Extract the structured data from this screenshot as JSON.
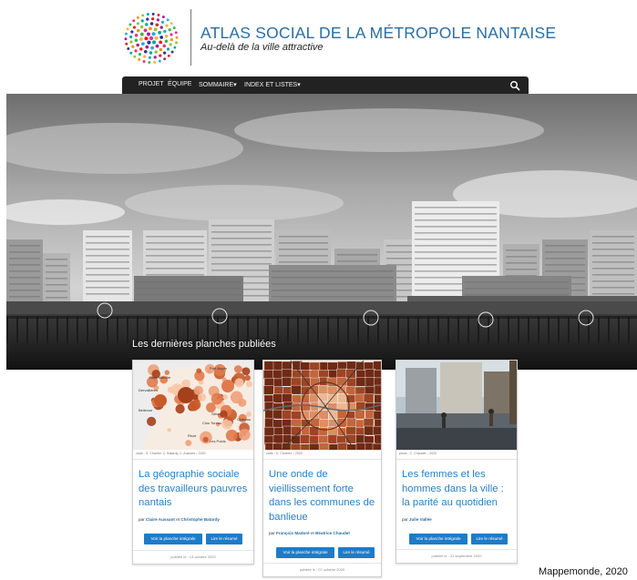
{
  "header": {
    "title": "ATLAS SOCIAL DE LA MÉTROPOLE NANTAISE",
    "subtitle": "Au-delà de la ville attractive"
  },
  "nav": {
    "items": [
      {
        "label": "PROJET"
      },
      {
        "label": "ÉQUIPE"
      },
      {
        "label": "SOMMAIRE▾"
      },
      {
        "label": "INDEX ET LISTES▾"
      }
    ],
    "search_icon": "search-icon"
  },
  "hero": {
    "caption": "Les dernières planches publiées"
  },
  "cards": [
    {
      "credit": "carte : G. Charrier, C. Batardy, C. Aussant – 2020",
      "title": "La géographie sociale des travailleurs pauvres nantais",
      "authors_prefix": "par",
      "author1": "Claire Aussant",
      "author_join": "et",
      "author2": "Christophe Batardy",
      "btn_full": "Voir la planche intégrale",
      "btn_summary": "Lire le résumé",
      "published": "publiée le : 13 octobre 2020",
      "map_labels": [
        "Port Boyer",
        "Nord Malville",
        "Dervallières",
        "Bellevue",
        "Sillon",
        "Clos Toreau",
        "Rezé",
        "Château",
        "Les Poids"
      ]
    },
    {
      "credit": "carte : G. Charrier – 2020",
      "title": "Une onde de vieillissement forte dans les communes de banlieue",
      "authors_prefix": "par",
      "author1": "François Madoré",
      "author_join": "et",
      "author2": "Béatrice Chaudet",
      "btn_full": "Voir la planche intégrale",
      "btn_summary": "Lire le résumé",
      "published": "publiée le : 07 octobre 2020"
    },
    {
      "credit": "photo : C. Chaudet – 2020",
      "title": "Les femmes et les hommes dans la ville : la parité au quotidien",
      "authors_prefix": "par",
      "author1": "Julie Vallée",
      "btn_full": "Voir la planche intégrale",
      "btn_summary": "Lire le résumé",
      "published": "publiée le : 21 septembre 2020"
    }
  ],
  "source_caption": "Mappemonde, 2020",
  "colors": {
    "brand_blue": "#2a6ea4",
    "link_blue": "#2a7fc4",
    "button_blue": "#1e7bc7",
    "navbar": "#222222"
  }
}
